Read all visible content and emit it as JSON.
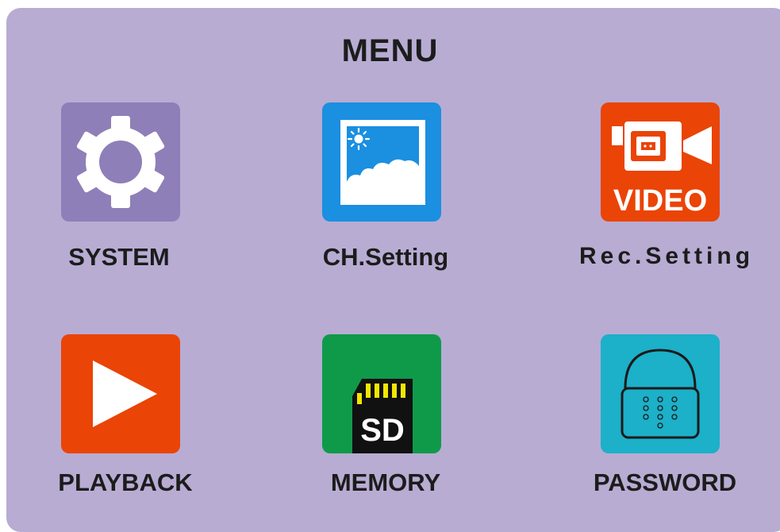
{
  "menu": {
    "title": "MENU",
    "items": [
      {
        "label": "SYSTEM",
        "icon": "gear-icon",
        "color": "#8e7fb8"
      },
      {
        "label": "CH.Setting",
        "icon": "picture-icon",
        "color": "#1b8fe0"
      },
      {
        "label": "Rec.Setting",
        "icon": "video-camera-icon",
        "color": "#ea4406",
        "icon_text": "VIDEO"
      },
      {
        "label": "PLAYBACK",
        "icon": "play-icon",
        "color": "#ea4406"
      },
      {
        "label": "MEMORY",
        "icon": "sd-card-icon",
        "color": "#0f9a4a",
        "icon_text": "SD"
      },
      {
        "label": "PASSWORD",
        "icon": "padlock-icon",
        "color": "#1cb0c9"
      }
    ]
  }
}
